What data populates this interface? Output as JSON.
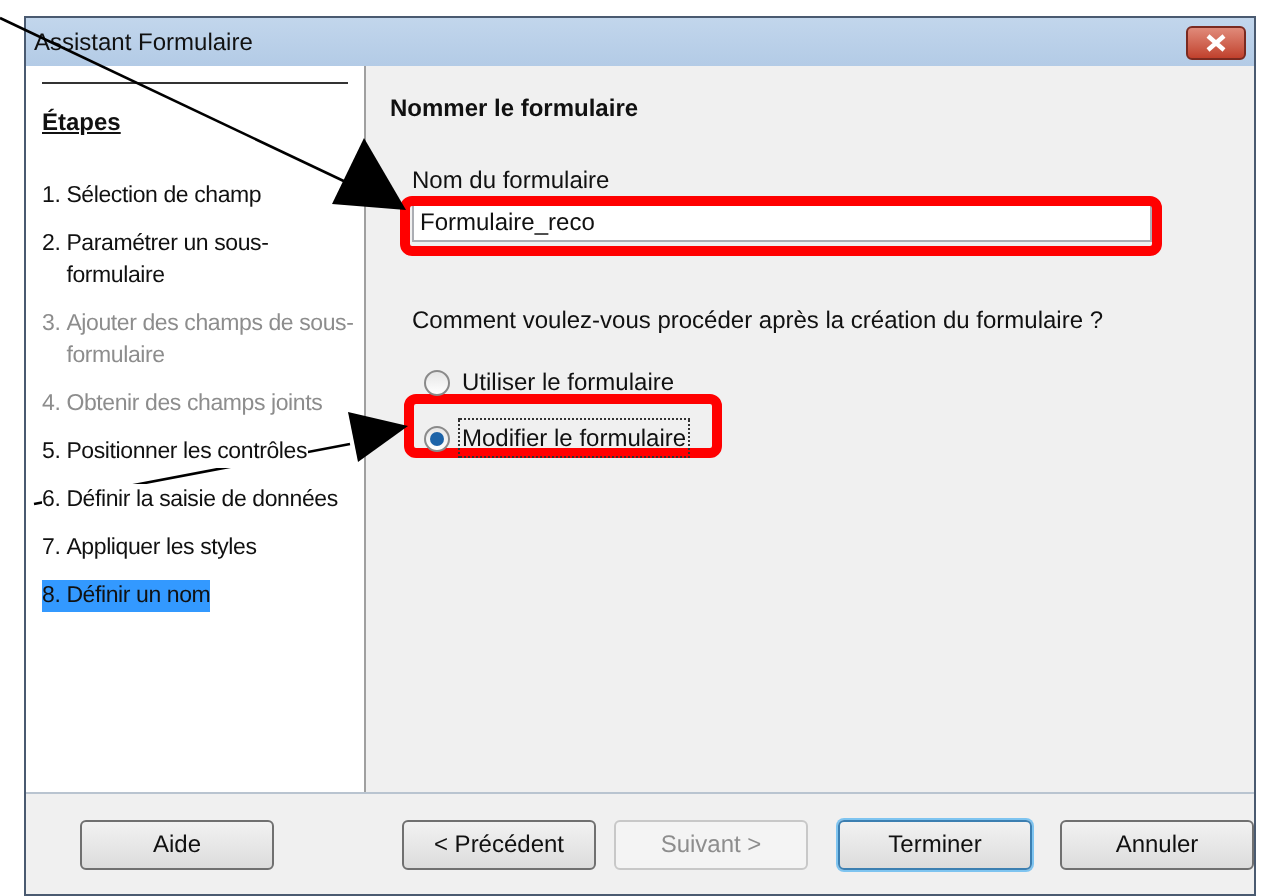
{
  "window": {
    "title": "Assistant Formulaire"
  },
  "sidebar": {
    "heading": "Étapes",
    "items": [
      {
        "number": "1.",
        "label": "Sélection de champ",
        "disabled": false,
        "selected": false
      },
      {
        "number": "2.",
        "label": "Paramétrer un sous-formulaire",
        "disabled": false,
        "selected": false
      },
      {
        "number": "3.",
        "label": "Ajouter des champs de sous-formulaire",
        "disabled": true,
        "selected": false
      },
      {
        "number": "4.",
        "label": "Obtenir des champs joints",
        "disabled": true,
        "selected": false
      },
      {
        "number": "5.",
        "label": "Positionner les contrôles",
        "disabled": false,
        "selected": false
      },
      {
        "number": "6.",
        "label": "Définir la saisie de données",
        "disabled": false,
        "selected": false
      },
      {
        "number": "7.",
        "label": "Appliquer les styles",
        "disabled": false,
        "selected": false
      },
      {
        "number": "8.",
        "label": "Définir un nom",
        "disabled": false,
        "selected": true
      }
    ]
  },
  "content": {
    "title": "Nommer le formulaire",
    "name_label": "Nom du formulaire",
    "name_value": "Formulaire_reco",
    "question": "Comment voulez-vous procéder après la création du formulaire ?",
    "options": [
      {
        "label": "Utiliser le formulaire",
        "selected": false
      },
      {
        "label": "Modifier le formulaire",
        "selected": true
      }
    ]
  },
  "buttons": [
    {
      "label": "Aide",
      "disabled": false,
      "default": false
    },
    {
      "label": "< Précédent",
      "disabled": false,
      "default": false
    },
    {
      "label": "Suivant >",
      "disabled": true,
      "default": false
    },
    {
      "label": "Terminer",
      "disabled": false,
      "default": true
    },
    {
      "label": "Annuler",
      "disabled": false,
      "default": false
    }
  ]
}
